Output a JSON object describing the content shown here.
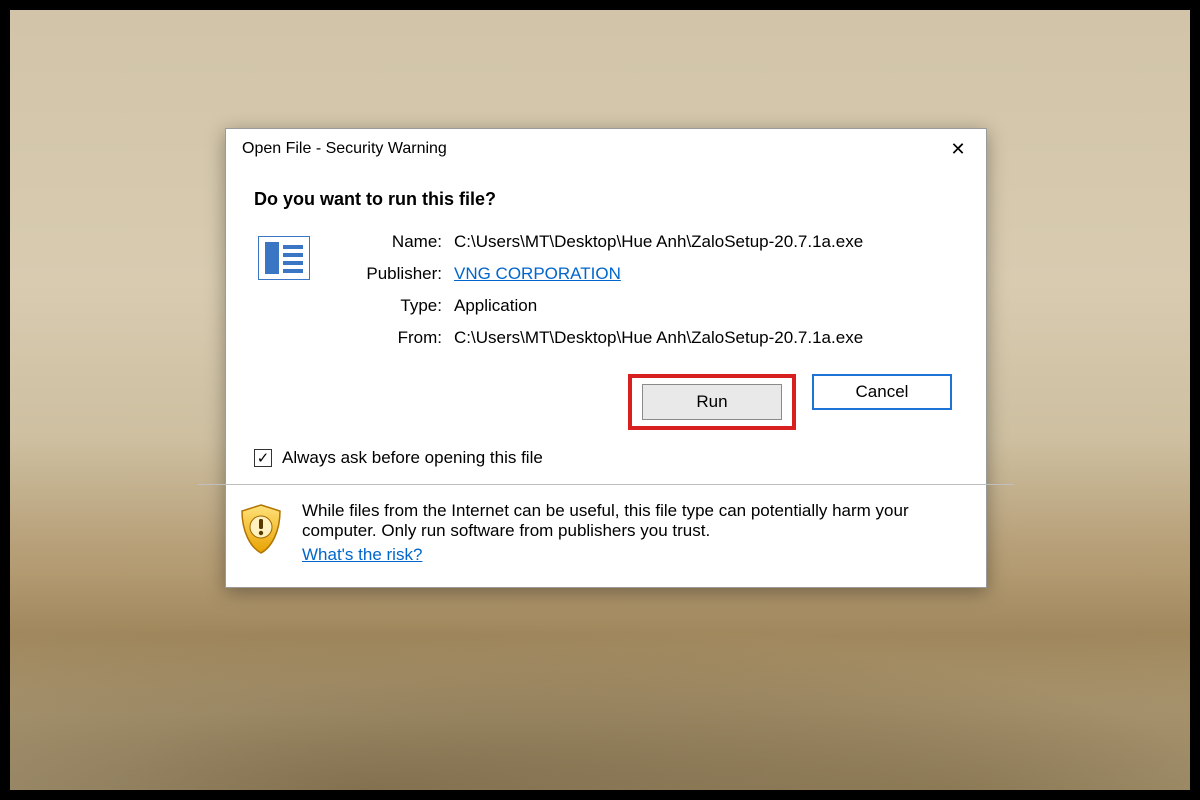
{
  "dialog": {
    "title": "Open File - Security Warning",
    "close_glyph": "✕",
    "heading": "Do you want to run this file?",
    "fields": {
      "name_label": "Name:",
      "name_value": "C:\\Users\\MT\\Desktop\\Hue Anh\\ZaloSetup-20.7.1a.exe",
      "publisher_label": "Publisher:",
      "publisher_value": "VNG CORPORATION",
      "type_label": "Type:",
      "type_value": "Application",
      "from_label": "From:",
      "from_value": "C:\\Users\\MT\\Desktop\\Hue Anh\\ZaloSetup-20.7.1a.exe"
    },
    "buttons": {
      "run": "Run",
      "cancel": "Cancel"
    },
    "checkbox": {
      "glyph": "✓",
      "label": "Always ask before opening this file"
    },
    "warning": {
      "text": "While files from the Internet can be useful, this file type can potentially harm your computer. Only run software from publishers you trust.",
      "risk_link": "What's the risk?"
    }
  }
}
